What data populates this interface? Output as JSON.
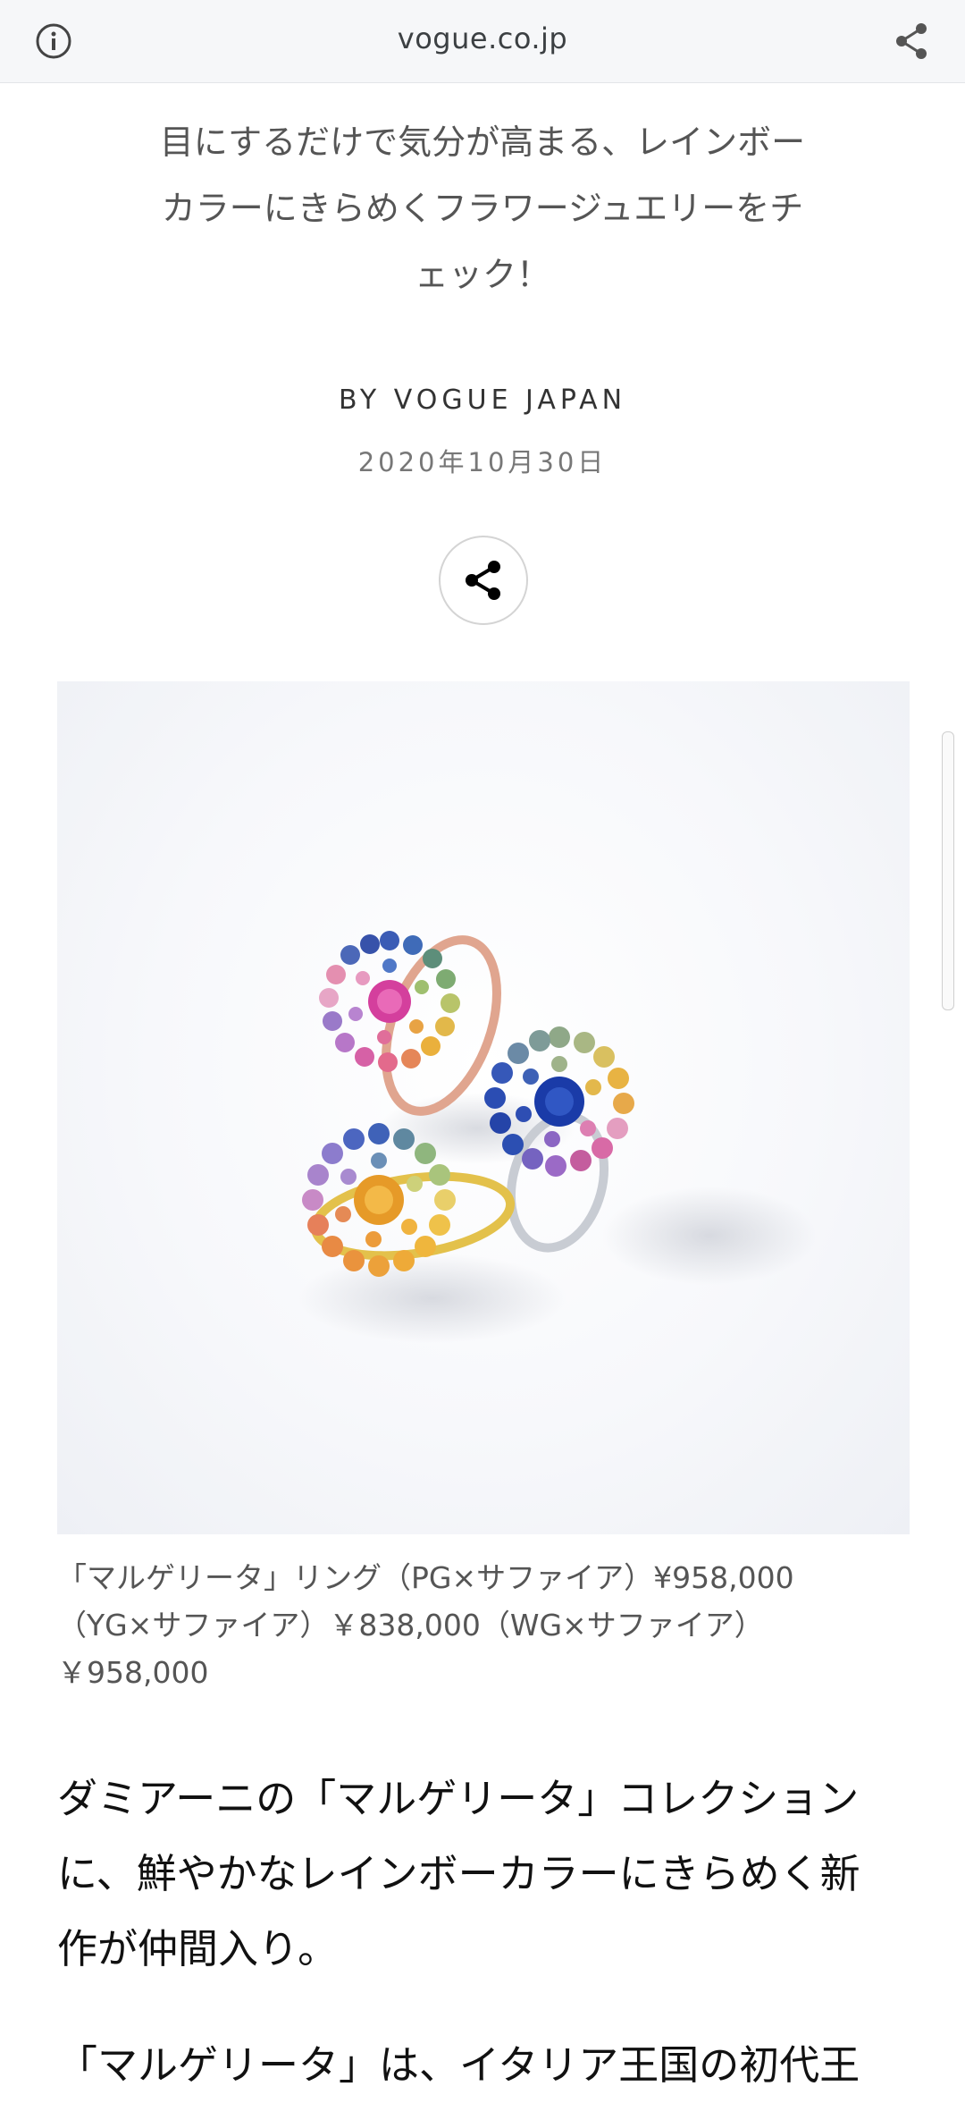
{
  "browser": {
    "domain": "vogue.co.jp",
    "info_icon": "info-circle-icon",
    "share_icon": "share-icon"
  },
  "article": {
    "subtitle_line1": "目にするだけで気分が高まる、レインボー",
    "subtitle_line2": "カラーにきらめくフラワージュエリーをチ",
    "subtitle_line3": "ェック！",
    "byline": "BY VOGUE JAPAN",
    "date": "2020年10月30日",
    "share_button_icon": "share-icon",
    "image_description_icon": "flower-rings-photo",
    "caption_line1": "「マルゲリータ」リング（PG×サファイア）¥958,000",
    "caption_line2": "（YG×サファイア）￥838,000（WG×サファイア）",
    "caption_line3": "￥958,000",
    "body_line1": "ダミアーニの「マルゲリータ」コレクション",
    "body_line2": "に、鮮やかなレインボーカラーにきらめく新",
    "body_line3": "作が仲間入り。",
    "body2_line1": "「マルゲリータ」は、イタリア王国の初代王"
  },
  "colors": {
    "topbar_bg": "#f6f7f9",
    "text_primary": "#111111",
    "text_muted": "#777777"
  }
}
